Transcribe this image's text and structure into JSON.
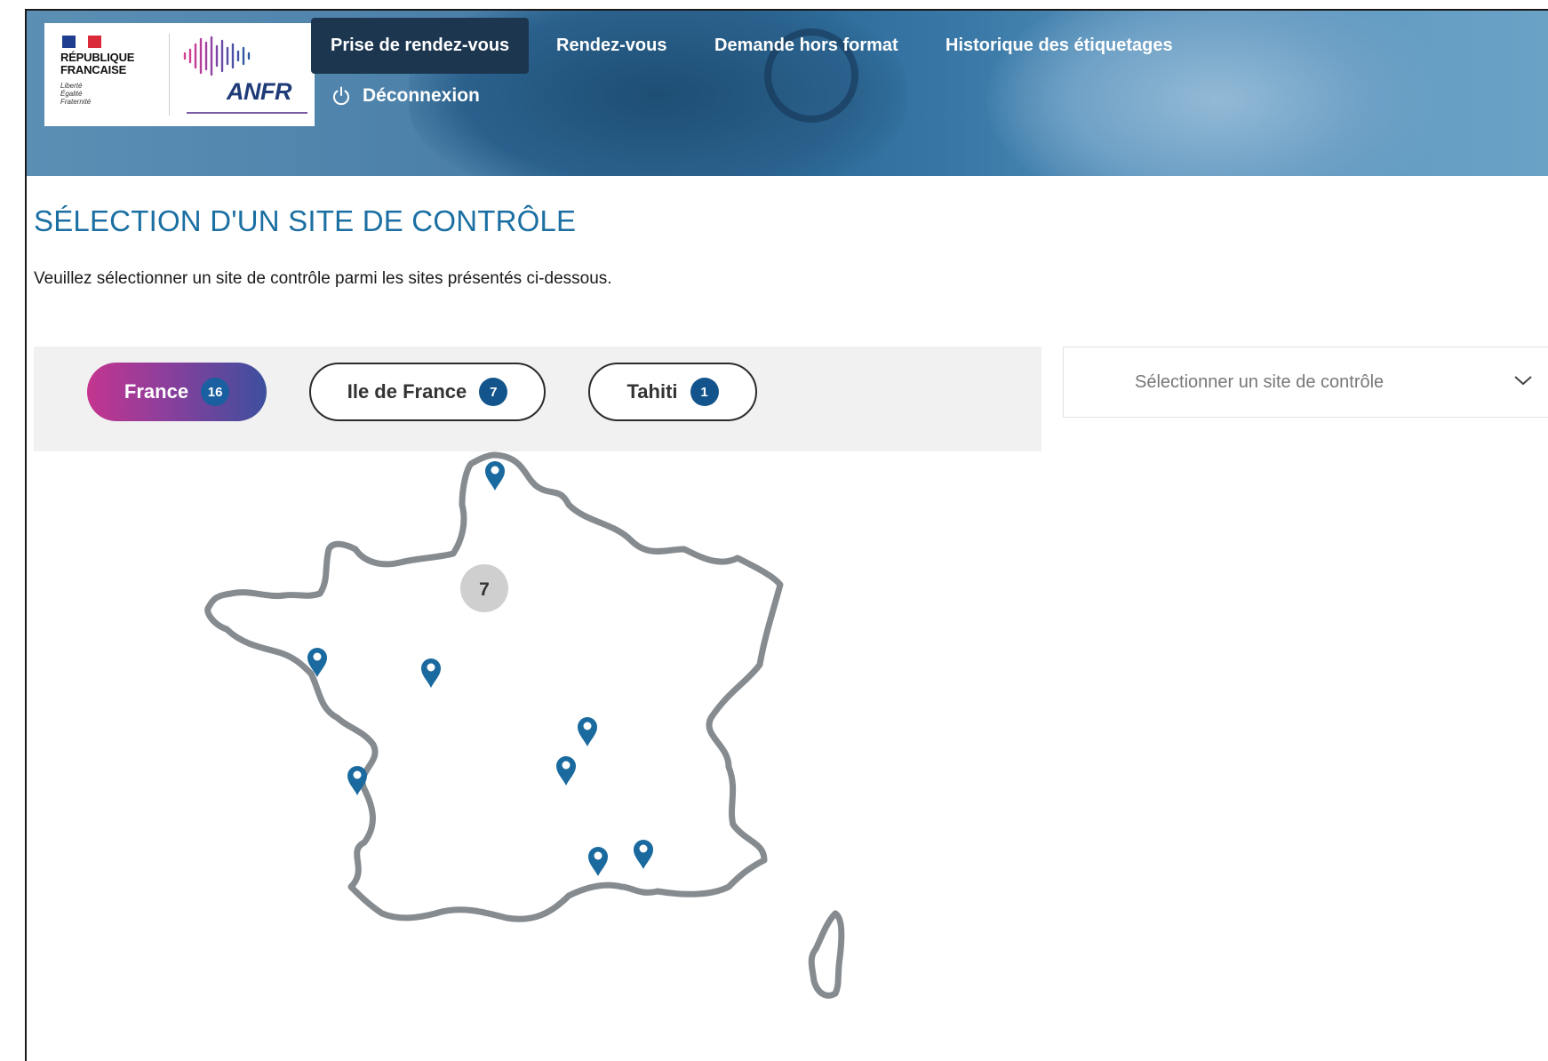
{
  "header": {
    "logo": {
      "republique": [
        "RÉPUBLIQUE",
        "FRANCAISE"
      ],
      "motto": [
        "Liberté",
        "Égalité",
        "Fraternité"
      ],
      "brand": "ANFR"
    },
    "nav": {
      "items": [
        {
          "label": "Prise de rendez-vous",
          "active": true
        },
        {
          "label": "Rendez-vous",
          "active": false
        },
        {
          "label": "Demande hors format",
          "active": false
        },
        {
          "label": "Historique des étiquetages",
          "active": false
        }
      ],
      "logout_label": "Déconnexion",
      "logout_icon": "power-icon"
    }
  },
  "page": {
    "title": "SÉLECTION D'UN SITE DE CONTRÔLE",
    "description": "Veuillez sélectionner un site de contrôle parmi les sites présentés ci-dessous."
  },
  "region_tabs": [
    {
      "label": "France",
      "count": "16",
      "active": true
    },
    {
      "label": "Ile de France",
      "count": "7",
      "active": false
    },
    {
      "label": "Tahiti",
      "count": "1",
      "active": false
    }
  ],
  "site_select": {
    "placeholder": "Sélectionner un site de contrôle",
    "icon": "chevron-down-icon"
  },
  "map": {
    "cluster_label": "7",
    "marker_icon": "map-pin-icon",
    "marker_count": 9
  },
  "colors": {
    "accent_title": "#1b6fa2",
    "marker": "#1a6aa0",
    "map_outline": "#868b90",
    "nav_active_bg": "#1c3650",
    "pill_gradient_start": "#c4358f",
    "pill_gradient_end": "#3d4f9e"
  }
}
